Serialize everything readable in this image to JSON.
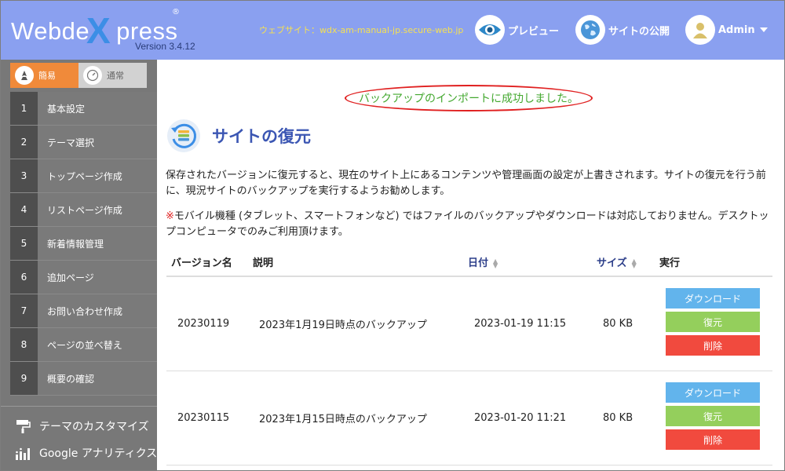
{
  "header": {
    "logo_left": "Webde",
    "logo_x": "X",
    "logo_right": "press",
    "logo_reg": "®",
    "version": "Version 3.4.12",
    "site_url": "ウェブサイト：wdx-am-manual-jp.secure-web.jp",
    "preview_label": "プレビュー",
    "publish_label": "サイトの公開",
    "admin_label": "Admin",
    "colors": {
      "bar": "#8aa0f0",
      "url": "#f5e052"
    }
  },
  "sidebar": {
    "modes": [
      {
        "label": "簡易",
        "active": true,
        "icon": "rocket-icon"
      },
      {
        "label": "通常",
        "active": false,
        "icon": "gauge-icon"
      }
    ],
    "items": [
      {
        "num": "1",
        "label": "基本設定"
      },
      {
        "num": "2",
        "label": "テーマ選択"
      },
      {
        "num": "3",
        "label": "トップページ作成"
      },
      {
        "num": "4",
        "label": "リストページ作成"
      },
      {
        "num": "5",
        "label": "新着情報管理"
      },
      {
        "num": "6",
        "label": "追加ページ"
      },
      {
        "num": "7",
        "label": "お問い合わせ作成"
      },
      {
        "num": "8",
        "label": "ページの並べ替え"
      },
      {
        "num": "9",
        "label": "概要の確認"
      }
    ],
    "tools": [
      {
        "label": "テーマのカスタマイズ",
        "icon": "paint-roller-icon"
      },
      {
        "label": "Google アナリティクス",
        "icon": "bar-chart-icon"
      }
    ]
  },
  "main": {
    "notice": "バックアップのインポートに成功しました。",
    "title": "サイトの復元",
    "description": "保存されたバージョンに復元すると、現在のサイト上にあるコンテンツや管理画面の設定が上書きされます。サイトの復元を行う前に、現況サイトのバックアップを実行するようお勧めします。",
    "warning_mark": "※",
    "warning": "モバイル機種 (タブレット、スマートフォンなど) ではファイルのバックアップやダウンロードは対応しておりません。デスクトップコンピュータでのみご利用頂けます。",
    "table": {
      "headers": {
        "version": "バージョン名",
        "description": "説明",
        "date": "日付",
        "size": "サイズ",
        "action": "実行"
      },
      "rows": [
        {
          "version": "20230119",
          "description": "2023年1月19日時点のバックアップ",
          "date": "2023-01-19 11:15",
          "size": "80 KB"
        },
        {
          "version": "20230115",
          "description": "2023年1月15日時点のバックアップ",
          "date": "2023-01-20 11:21",
          "size": "80 KB"
        }
      ],
      "actions": {
        "download": "ダウンロード",
        "restore": "復元",
        "delete": "削除"
      }
    }
  }
}
